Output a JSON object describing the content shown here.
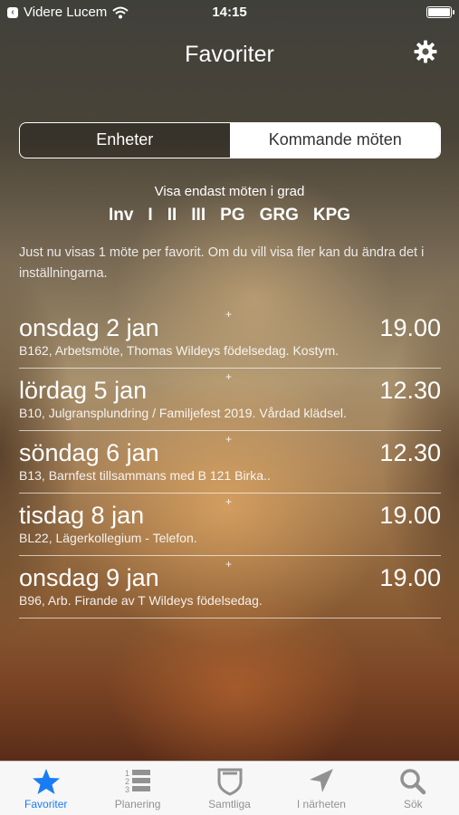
{
  "status_bar": {
    "back_app": "Videre Lucem",
    "time": "14:15"
  },
  "nav": {
    "title": "Favoriter",
    "settings_icon": "gear-icon"
  },
  "segment": {
    "options": [
      "Enheter",
      "Kommande möten"
    ],
    "selected": "Kommande möten"
  },
  "grade_filter": {
    "caption": "Visa endast möten i grad",
    "grades": [
      "Inv",
      "I",
      "II",
      "III",
      "PG",
      "GRG",
      "KPG"
    ]
  },
  "info_text": "Just nu visas 1 möte per favorit. Om du vill visa fler kan du ändra det i inställningarna.",
  "meetings": [
    {
      "date": "onsdag 2 jan",
      "time": "19.00",
      "desc": "B162, Arbetsmöte, Thomas Wildeys födelsedag. Kostym.",
      "marker": "+"
    },
    {
      "date": "lördag 5 jan",
      "time": "12.30",
      "desc": "B10, Julgransplundring / Familjefest 2019. Vårdad klädsel.",
      "marker": "+"
    },
    {
      "date": "söndag 6 jan",
      "time": "12.30",
      "desc": "B13, Barnfest tillsammans med B 121 Birka..",
      "marker": "+"
    },
    {
      "date": "tisdag 8 jan",
      "time": "19.00",
      "desc": "BL22, Lägerkollegium - Telefon.",
      "marker": "+"
    },
    {
      "date": "onsdag 9 jan",
      "time": "19.00",
      "desc": "B96, Arb. Firande av T Wildeys födelsedag.",
      "marker": "+"
    }
  ],
  "tabbar": {
    "tabs": [
      {
        "label": "Favoriter",
        "icon": "star-icon",
        "active": true
      },
      {
        "label": "Planering",
        "icon": "numbered-list-icon",
        "active": false
      },
      {
        "label": "Samtliga",
        "icon": "shield-icon",
        "active": false
      },
      {
        "label": "I närheten",
        "icon": "location-arrow-icon",
        "active": false
      },
      {
        "label": "Sök",
        "icon": "search-icon",
        "active": false
      }
    ]
  },
  "colors": {
    "accent": "#1a7cf5",
    "tab_inactive": "#929292",
    "tabbar_bg": "#f7f7f7"
  }
}
